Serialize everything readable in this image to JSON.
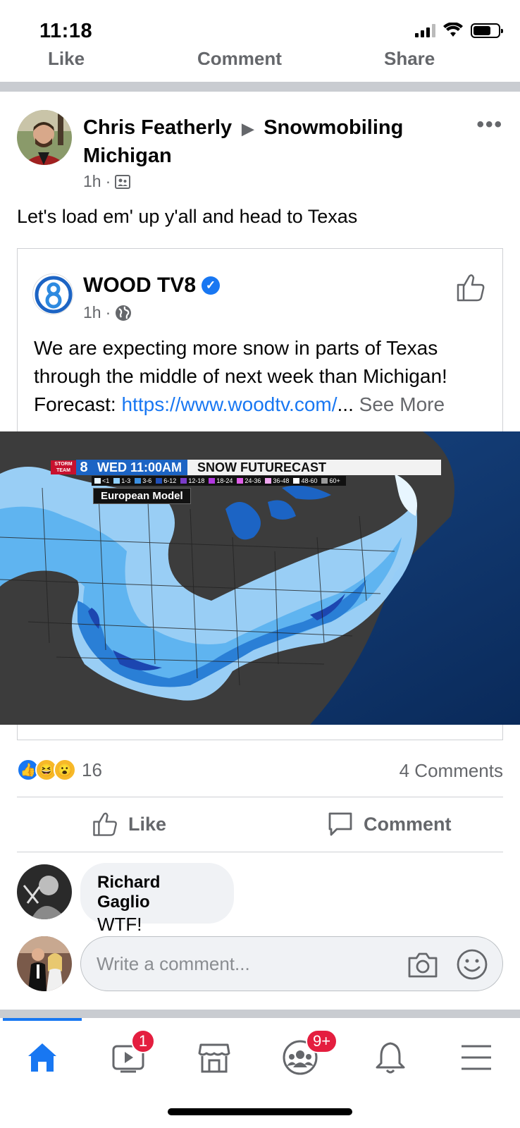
{
  "status_bar": {
    "time": "11:18"
  },
  "prev_post_actions": {
    "like": "Like",
    "comment": "Comment",
    "share": "Share"
  },
  "post": {
    "author": "Chris Featherly",
    "group": "Snowmobiling Michigan",
    "time": "1h",
    "text": "Let's load em' up y'all and head to Texas"
  },
  "shared": {
    "page_name": "WOOD TV8",
    "time": "1h",
    "text_before_link": "We are expecting more snow in parts of Texas through the middle of next week than Michigan! Forecast: ",
    "link": "https://www.woodtv.com/",
    "ellipsis": "...",
    "see_more": "See More",
    "image": {
      "logo_storm": "STORM",
      "logo_team": "TEAM",
      "logo_number": "8",
      "day_time": "WED   11:00AM",
      "title": "SNOW FUTURECAST",
      "legend": [
        {
          "label": "<1",
          "color": "#e6f4ff"
        },
        {
          "label": "1-3",
          "color": "#8fd0ff"
        },
        {
          "label": "3-6",
          "color": "#3b8fe0"
        },
        {
          "label": "6-12",
          "color": "#1f4fb8"
        },
        {
          "label": "12-18",
          "color": "#7a3cc8"
        },
        {
          "label": "18-24",
          "color": "#b238e0"
        },
        {
          "label": "24-36",
          "color": "#e060e8"
        },
        {
          "label": "36-48",
          "color": "#f0a8f0"
        },
        {
          "label": "48-60",
          "color": "#ffffff"
        },
        {
          "label": "60+",
          "color": "#9a9a9a"
        }
      ],
      "model": "European Model"
    }
  },
  "engagement": {
    "reaction_count": "16",
    "comments_count": "4 Comments",
    "like_label": "Like",
    "comment_label": "Comment"
  },
  "comment": {
    "author": "Richard Gaglio",
    "text": "WTF!"
  },
  "write_comment": {
    "placeholder": "Write a comment..."
  },
  "bottom_nav": {
    "watch_badge": "1",
    "groups_badge": "9+"
  },
  "colors": {
    "accent": "#1877f2",
    "badge": "#e41e3f",
    "secondary_text": "#65676b"
  }
}
